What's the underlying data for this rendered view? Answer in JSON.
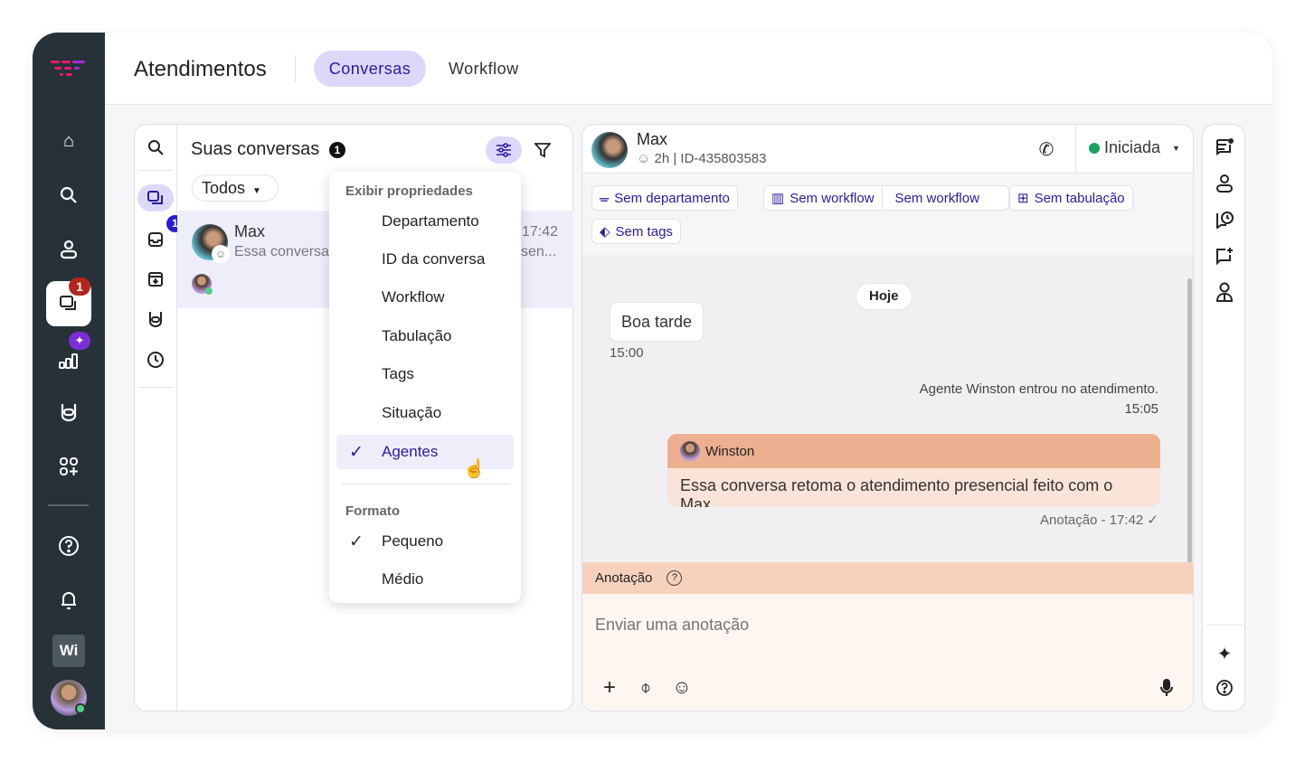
{
  "header": {
    "title": "Atendimentos",
    "tabs": [
      {
        "label": "Conversas",
        "active": true
      },
      {
        "label": "Workflow",
        "active": false
      }
    ]
  },
  "sidebar": {
    "items": [
      "home-icon",
      "search-icon",
      "contacts-icon",
      "conversations-icon",
      "reports-icon",
      "bot-icon",
      "apps-icon",
      "help-icon",
      "bell-icon"
    ],
    "conversations_badge": "1",
    "workspace": "Wi",
    "accent": "#7b2fd6"
  },
  "list": {
    "title": "Suas conversas",
    "count": "1",
    "filter": "Todos",
    "inbox_badge": "1",
    "items": [
      {
        "name": "Max",
        "preview": "Essa conversa",
        "preview_tail": "sen...",
        "time": "17:42"
      }
    ]
  },
  "menu": {
    "section1": "Exibir propriedades",
    "items": [
      {
        "label": "Departamento"
      },
      {
        "label": "ID da conversa"
      },
      {
        "label": "Workflow"
      },
      {
        "label": "Tabulação"
      },
      {
        "label": "Tags"
      },
      {
        "label": "Situação"
      },
      {
        "label": "Agentes",
        "checked": true
      }
    ],
    "section2": "Formato",
    "formats": [
      {
        "label": "Pequeno",
        "checked": true
      },
      {
        "label": "Médio"
      }
    ]
  },
  "chat": {
    "name": "Max",
    "meta": "2h | ID-435803583",
    "status": "Iniciada",
    "status_color": "#1aa260",
    "chips": [
      "Sem departamento",
      "Sem workflow",
      "Sem workflow",
      "Sem tabulação",
      "Sem tags"
    ],
    "day": "Hoje",
    "msg1": {
      "text": "Boa tarde",
      "time": "15:00"
    },
    "system": {
      "text": "Agente Winston entrou no atendimento.",
      "time": "15:05"
    },
    "note": {
      "author": "Winston",
      "text": "Essa conversa retoma o atendimento presencial feito com o Max",
      "meta": "Anotação - 17:42 ✓"
    },
    "composer": {
      "label": "Anotação",
      "placeholder": "Enviar uma anotação"
    }
  }
}
